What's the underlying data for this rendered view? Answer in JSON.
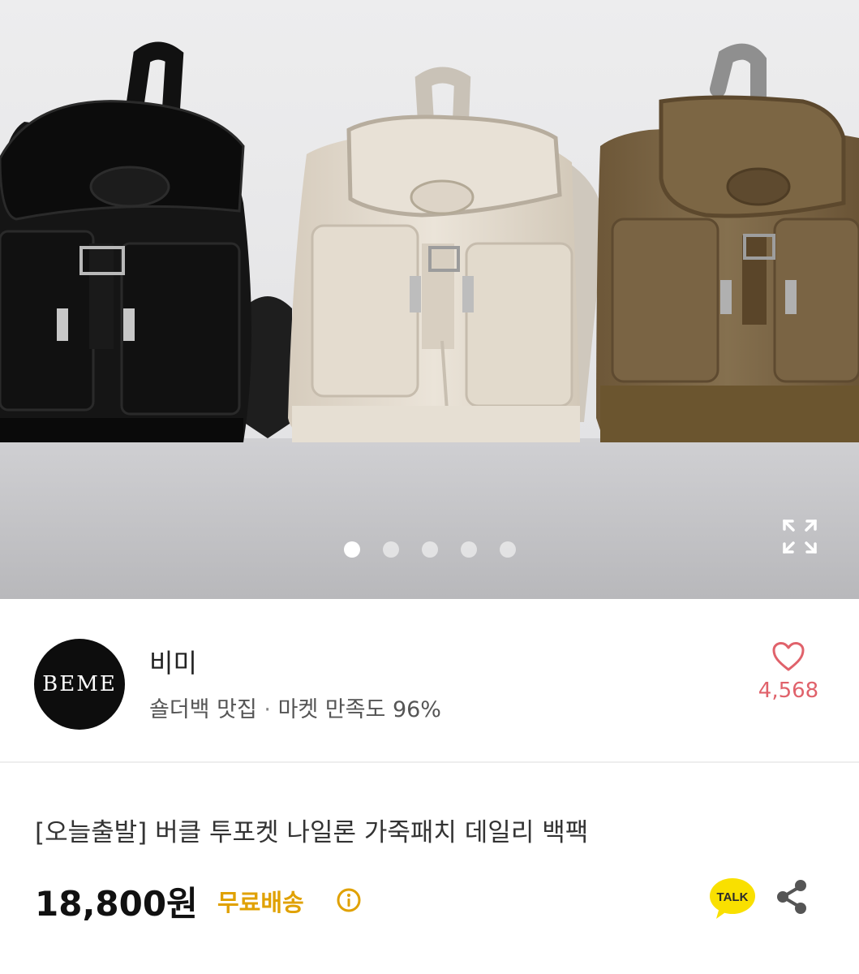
{
  "gallery": {
    "dots_count": 5,
    "active_dot": 0,
    "expand_icon": "expand-icon",
    "colors": {
      "wall": "#e9e9eb",
      "floor": "#c9c9cc",
      "bag_black": "#141414",
      "bag_beige": "#dcd3c6",
      "bag_brown": "#7a6443"
    }
  },
  "seller": {
    "logo_text": "BEME",
    "name": "비미",
    "tag": "숄더백 맛집",
    "separator": "·",
    "satisfaction": "마켓 만족도 96%",
    "like_icon": "heart-icon",
    "like_count": "4,568"
  },
  "product": {
    "title": "[오늘출발] 버클 투포켓 나일론 가죽패치 데일리 백팩",
    "price": "18,800원",
    "shipping": "무료배송",
    "info_icon": "info-icon",
    "talk_icon": "talk-icon",
    "talk_label": "TALK",
    "share_icon": "share-icon"
  },
  "colors": {
    "accent_pink": "#e0626b",
    "shipping_yellow": "#e0a100",
    "talk_yellow": "#f9e000"
  }
}
